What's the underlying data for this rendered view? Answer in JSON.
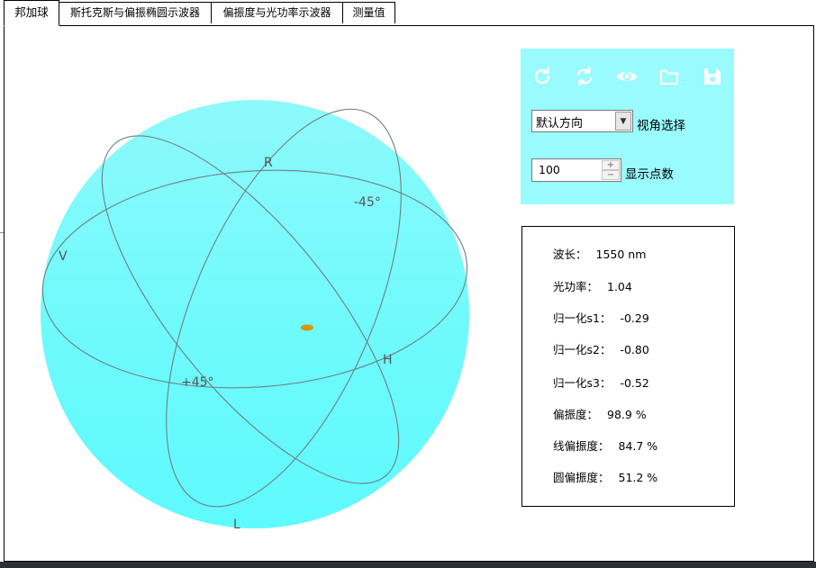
{
  "tabs": [
    {
      "label": "邦加球",
      "active": true
    },
    {
      "label": "斯托克斯与偏振椭圆示波器",
      "active": false
    },
    {
      "label": "偏振度与光功率示波器",
      "active": false
    },
    {
      "label": "测量值",
      "active": false
    }
  ],
  "sphere": {
    "labels": {
      "R": "R",
      "L": "L",
      "H": "H",
      "V": "V",
      "plus45": "+45°",
      "minus45": "-45°"
    },
    "fill_color": "#62fbfd",
    "point_color": "#d39a00"
  },
  "controls": {
    "icons": [
      "refresh-icon",
      "sync-icon",
      "eye-icon",
      "folder-icon",
      "save-icon"
    ],
    "view_select": {
      "value": "默认方向",
      "label": "视角选择"
    },
    "points_input": {
      "value": "100",
      "label": "显示点数"
    },
    "panel_color": "#99fbfd"
  },
  "measurements": [
    {
      "label": "波长：",
      "value": "1550 nm"
    },
    {
      "label": "光功率：",
      "value": "1.04"
    },
    {
      "label": "归一化s1：",
      "value": "-0.29"
    },
    {
      "label": "归一化s2：",
      "value": "-0.80"
    },
    {
      "label": "归一化s3：",
      "value": "-0.52"
    },
    {
      "label": "偏振度：",
      "value": "98.9 %"
    },
    {
      "label": "线偏振度：",
      "value": "84.7 %"
    },
    {
      "label": "圆偏振度：",
      "value": "51.2 %"
    }
  ]
}
